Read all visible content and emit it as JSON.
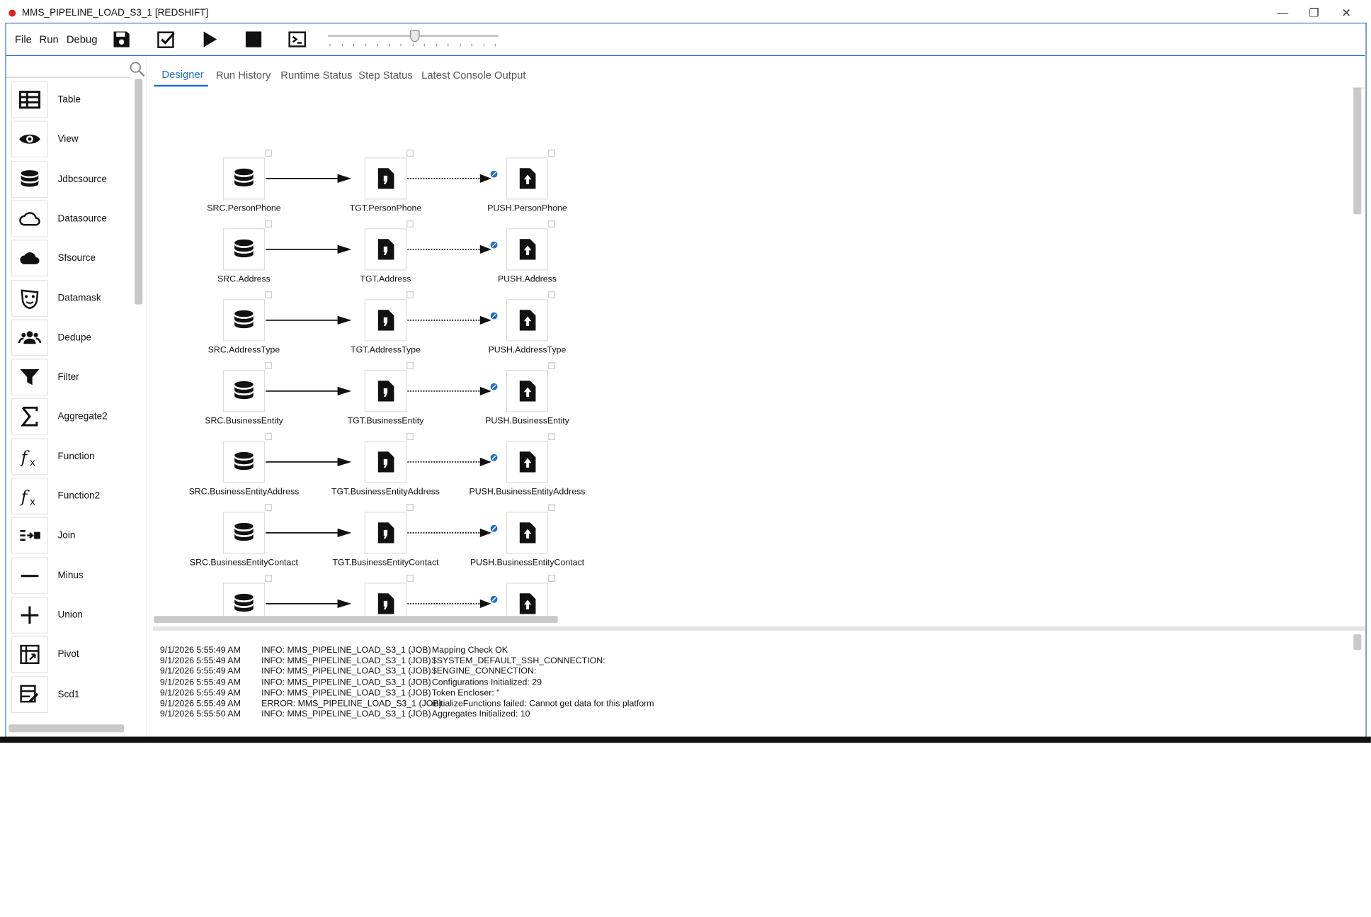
{
  "window": {
    "title": "MMS_PIPELINE_LOAD_S3_1 [REDSHIFT]",
    "controls": [
      "—",
      "❐",
      "✕"
    ]
  },
  "menu": {
    "file": "File",
    "run": "Run",
    "debug": "Debug"
  },
  "toolbar": {
    "buttons": [
      "save-icon",
      "validate-icon",
      "play-icon",
      "stop-icon",
      "console-icon"
    ]
  },
  "palette": {
    "items": [
      {
        "label": "Table",
        "icon": "table-icon"
      },
      {
        "label": "View",
        "icon": "eye-icon"
      },
      {
        "label": "Jdbcsource",
        "icon": "database-icon"
      },
      {
        "label": "Datasource",
        "icon": "cloud-outline-icon"
      },
      {
        "label": "Sfsource",
        "icon": "cloud-filled-icon"
      },
      {
        "label": "Datamask",
        "icon": "mask-icon"
      },
      {
        "label": "Dedupe",
        "icon": "people-icon"
      },
      {
        "label": "Filter",
        "icon": "filter-icon"
      },
      {
        "label": "Aggregate2",
        "icon": "sigma-icon"
      },
      {
        "label": "Function",
        "icon": "function-icon"
      },
      {
        "label": "Function2",
        "icon": "function-icon"
      },
      {
        "label": "Join",
        "icon": "join-icon"
      },
      {
        "label": "Minus",
        "icon": "minus-icon"
      },
      {
        "label": "Union",
        "icon": "plus-icon"
      },
      {
        "label": "Pivot",
        "icon": "pivot-icon"
      },
      {
        "label": "Scd1",
        "icon": "scd-icon"
      }
    ]
  },
  "tabs": [
    {
      "label": "Designer",
      "active": true
    },
    {
      "label": "Run History",
      "active": false
    },
    {
      "label": "Runtime Status",
      "active": false
    },
    {
      "label": "Step Status",
      "active": false
    },
    {
      "label": "Latest Console Output",
      "active": false
    }
  ],
  "pipelines": [
    {
      "src": "SRC.PersonPhone",
      "tgt": "TGT.PersonPhone",
      "push": "PUSH.PersonPhone"
    },
    {
      "src": "SRC.Address",
      "tgt": "TGT.Address",
      "push": "PUSH.Address"
    },
    {
      "src": "SRC.AddressType",
      "tgt": "TGT.AddressType",
      "push": "PUSH.AddressType"
    },
    {
      "src": "SRC.BusinessEntity",
      "tgt": "TGT.BusinessEntity",
      "push": "PUSH.BusinessEntity"
    },
    {
      "src": "SRC.BusinessEntityAddress",
      "tgt": "TGT.BusinessEntityAddress",
      "push": "PUSH.BusinessEntityAddress"
    },
    {
      "src": "SRC.BusinessEntityContact",
      "tgt": "TGT.BusinessEntityContact",
      "push": "PUSH.BusinessEntityContact"
    },
    {
      "src": "",
      "tgt": "",
      "push": ""
    }
  ],
  "console": [
    {
      "time": "9/1/2026 5:55:49 AM",
      "source": "INFO: MMS_PIPELINE_LOAD_S3_1 (JOB)",
      "message": "Mapping Check OK"
    },
    {
      "time": "9/1/2026 5:55:49 AM",
      "source": "INFO: MMS_PIPELINE_LOAD_S3_1 (JOB)",
      "message": "$SYSTEM_DEFAULT_SSH_CONNECTION:"
    },
    {
      "time": "9/1/2026 5:55:49 AM",
      "source": "INFO: MMS_PIPELINE_LOAD_S3_1 (JOB)",
      "message": "$ENGINE_CONNECTION:"
    },
    {
      "time": "9/1/2026 5:55:49 AM",
      "source": "INFO: MMS_PIPELINE_LOAD_S3_1 (JOB)",
      "message": "Configurations Initialized: 29"
    },
    {
      "time": "9/1/2026 5:55:49 AM",
      "source": "INFO: MMS_PIPELINE_LOAD_S3_1 (JOB)",
      "message": "Token Encloser: \""
    },
    {
      "time": "9/1/2026 5:55:49 AM",
      "source": "ERROR: MMS_PIPELINE_LOAD_S3_1 (JOB)",
      "message": "initializeFunctions failed: Cannot get data for this platform"
    },
    {
      "time": "9/1/2026 5:55:50 AM",
      "source": "INFO: MMS_PIPELINE_LOAD_S3_1 (JOB)",
      "message": "Aggregates Initialized: 10"
    }
  ],
  "colors": {
    "accent": "#1f6fc7",
    "frame": "#2b6cb7",
    "link": "#1f6fc7"
  }
}
